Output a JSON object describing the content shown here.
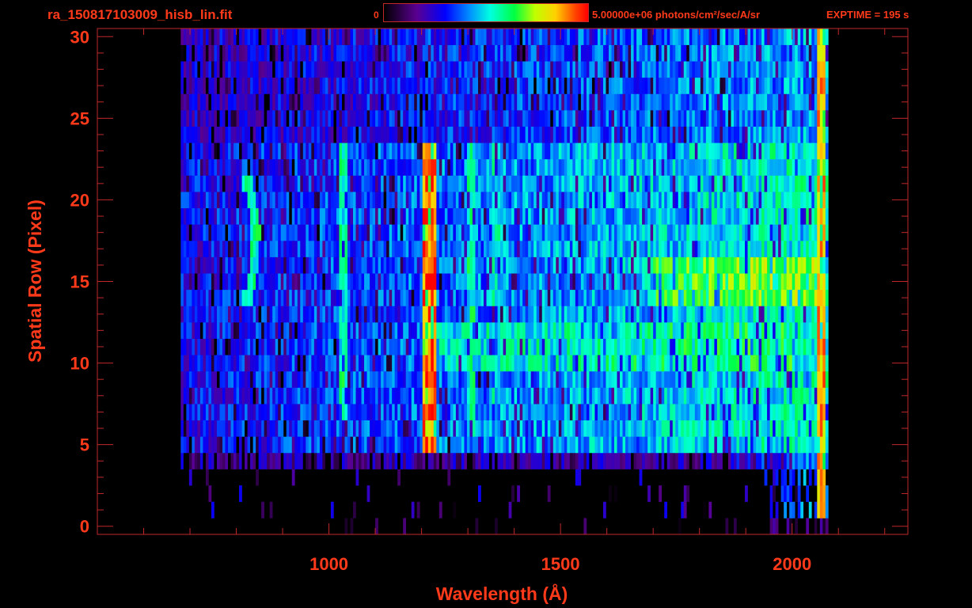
{
  "header": {
    "file_name": "ra_150817103009_hisb_lin.fit",
    "colorbar_min": "0",
    "colorbar_max": "5.00000e+06 photons/cm²/sec/A/sr",
    "exptime": "EXPTIME = 195 s"
  },
  "colors": {
    "axis": "#c0282a",
    "text": "#ff3a1a",
    "background": "#000000"
  },
  "chart_data": {
    "type": "heatmap",
    "title": "ra_150817103009_hisb_lin.fit",
    "xlabel": "Wavelength (Å)",
    "ylabel": "Spatial Row (Pixel)",
    "xlim": [
      500,
      2250
    ],
    "ylim": [
      -0.5,
      30.5
    ],
    "x_ticks": [
      1000,
      1500,
      2000
    ],
    "y_ticks": [
      0,
      5,
      10,
      15,
      20,
      25,
      30
    ],
    "colorbar": {
      "min": 0,
      "max": 5000000,
      "unit": "photons/cm2/sec/A/sr"
    },
    "data_extent": {
      "x_min": 680,
      "x_max": 2075,
      "row_min": 0,
      "row_max": 30
    },
    "features": [
      {
        "name": "Lyman-alpha",
        "wavelength": 1216,
        "rows": [
          5,
          23
        ],
        "level": 0.92
      },
      {
        "name": "emission line",
        "wavelength": 1026,
        "rows": [
          7,
          23
        ],
        "level": 0.55
      },
      {
        "name": "emission line",
        "wavelength": 1304,
        "rows": [
          6,
          23
        ],
        "level": 0.55
      },
      {
        "name": "emission line",
        "wavelength": 1356,
        "rows": [
          8,
          23
        ],
        "level": 0.5
      },
      {
        "name": "arc",
        "wavelength": 800,
        "rows": [
          14,
          21
        ],
        "level": 0.55
      },
      {
        "name": "band",
        "wavelength_range": [
          1216,
          2000
        ],
        "rows": [
          10,
          12
        ],
        "level": 0.5
      },
      {
        "name": "band",
        "wavelength_range": [
          1700,
          2050
        ],
        "rows": [
          14,
          16
        ],
        "level": 0.62
      },
      {
        "name": "edge",
        "wavelength": 2060,
        "rows": [
          1,
          30
        ],
        "level": 0.85
      }
    ]
  }
}
